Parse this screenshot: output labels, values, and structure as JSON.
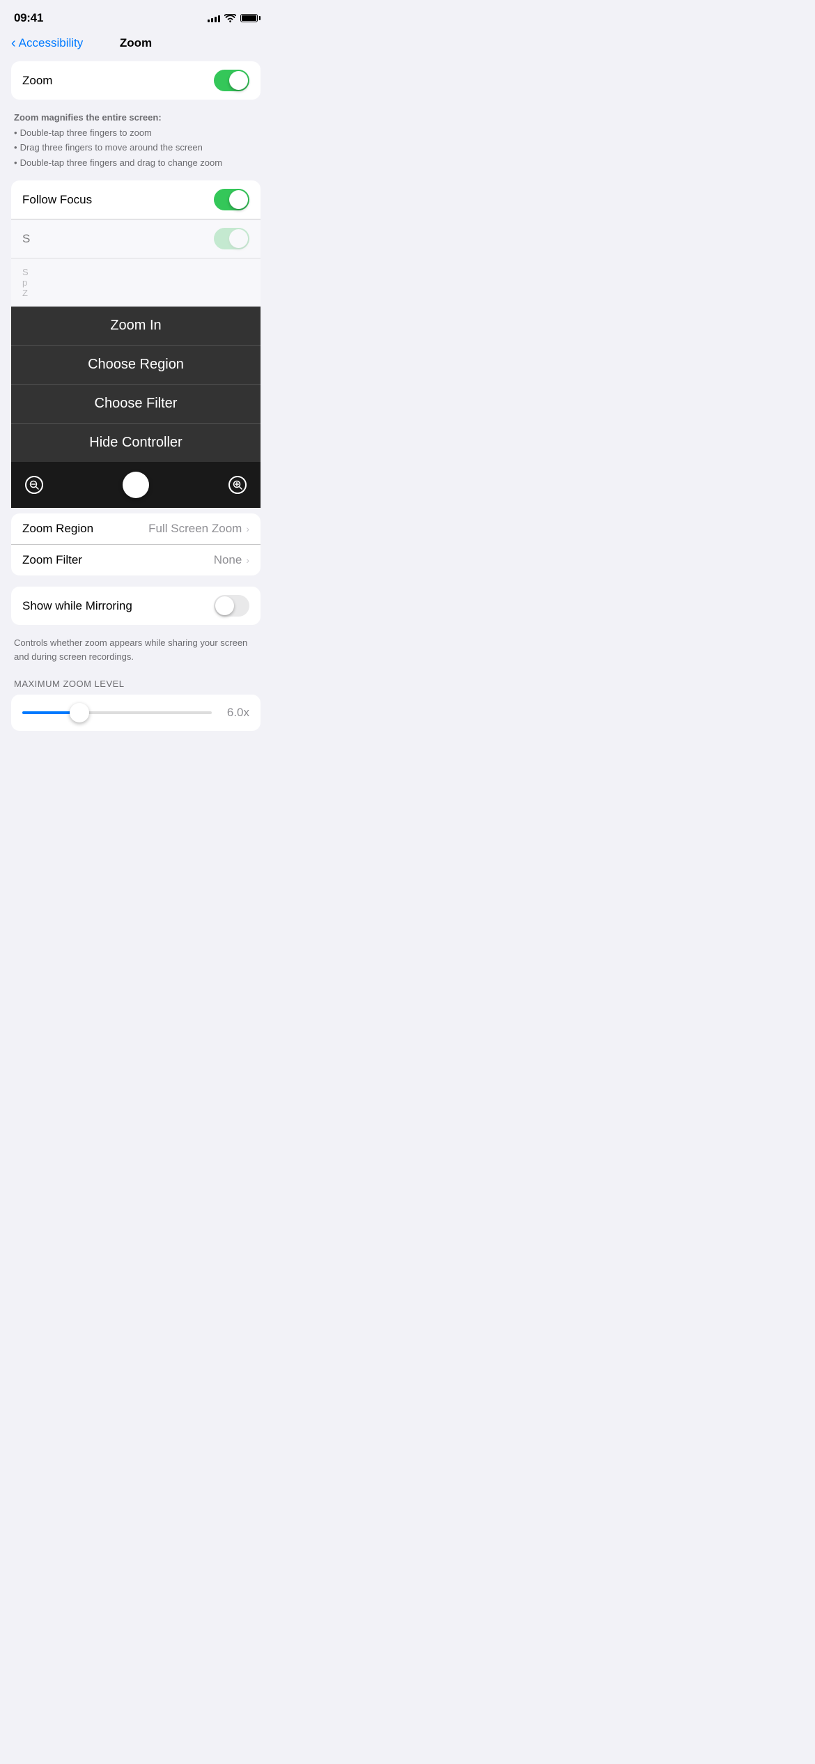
{
  "statusBar": {
    "time": "09:41",
    "signalBars": [
      4,
      6,
      8,
      10,
      12
    ],
    "batteryLevel": "full"
  },
  "header": {
    "backLabel": "Accessibility",
    "title": "Zoom"
  },
  "zoomToggle": {
    "label": "Zoom",
    "enabled": true
  },
  "description": {
    "heading": "Zoom magnifies the entire screen:",
    "bullets": [
      "Double-tap three fingers to zoom",
      "Drag three fingers to move around the screen",
      "Double-tap three fingers and drag to change zoom"
    ]
  },
  "followFocus": {
    "label": "Follow Focus",
    "enabled": true
  },
  "contextMenu": {
    "items": [
      {
        "id": "zoom-in",
        "label": "Zoom In"
      },
      {
        "id": "choose-region",
        "label": "Choose Region"
      },
      {
        "id": "choose-filter",
        "label": "Choose Filter"
      },
      {
        "id": "hide-controller",
        "label": "Hide Controller"
      }
    ]
  },
  "zoomRegion": {
    "label": "Zoom Region",
    "value": "Full Screen Zoom"
  },
  "zoomFilter": {
    "label": "Zoom Filter",
    "value": "None"
  },
  "showWhileMirroring": {
    "label": "Show while Mirroring",
    "enabled": false,
    "description": "Controls whether zoom appears while sharing your screen and during screen recordings."
  },
  "maxZoomLevel": {
    "sectionLabel": "MAXIMUM ZOOM LEVEL",
    "value": "6.0x",
    "fillPercent": 30
  }
}
